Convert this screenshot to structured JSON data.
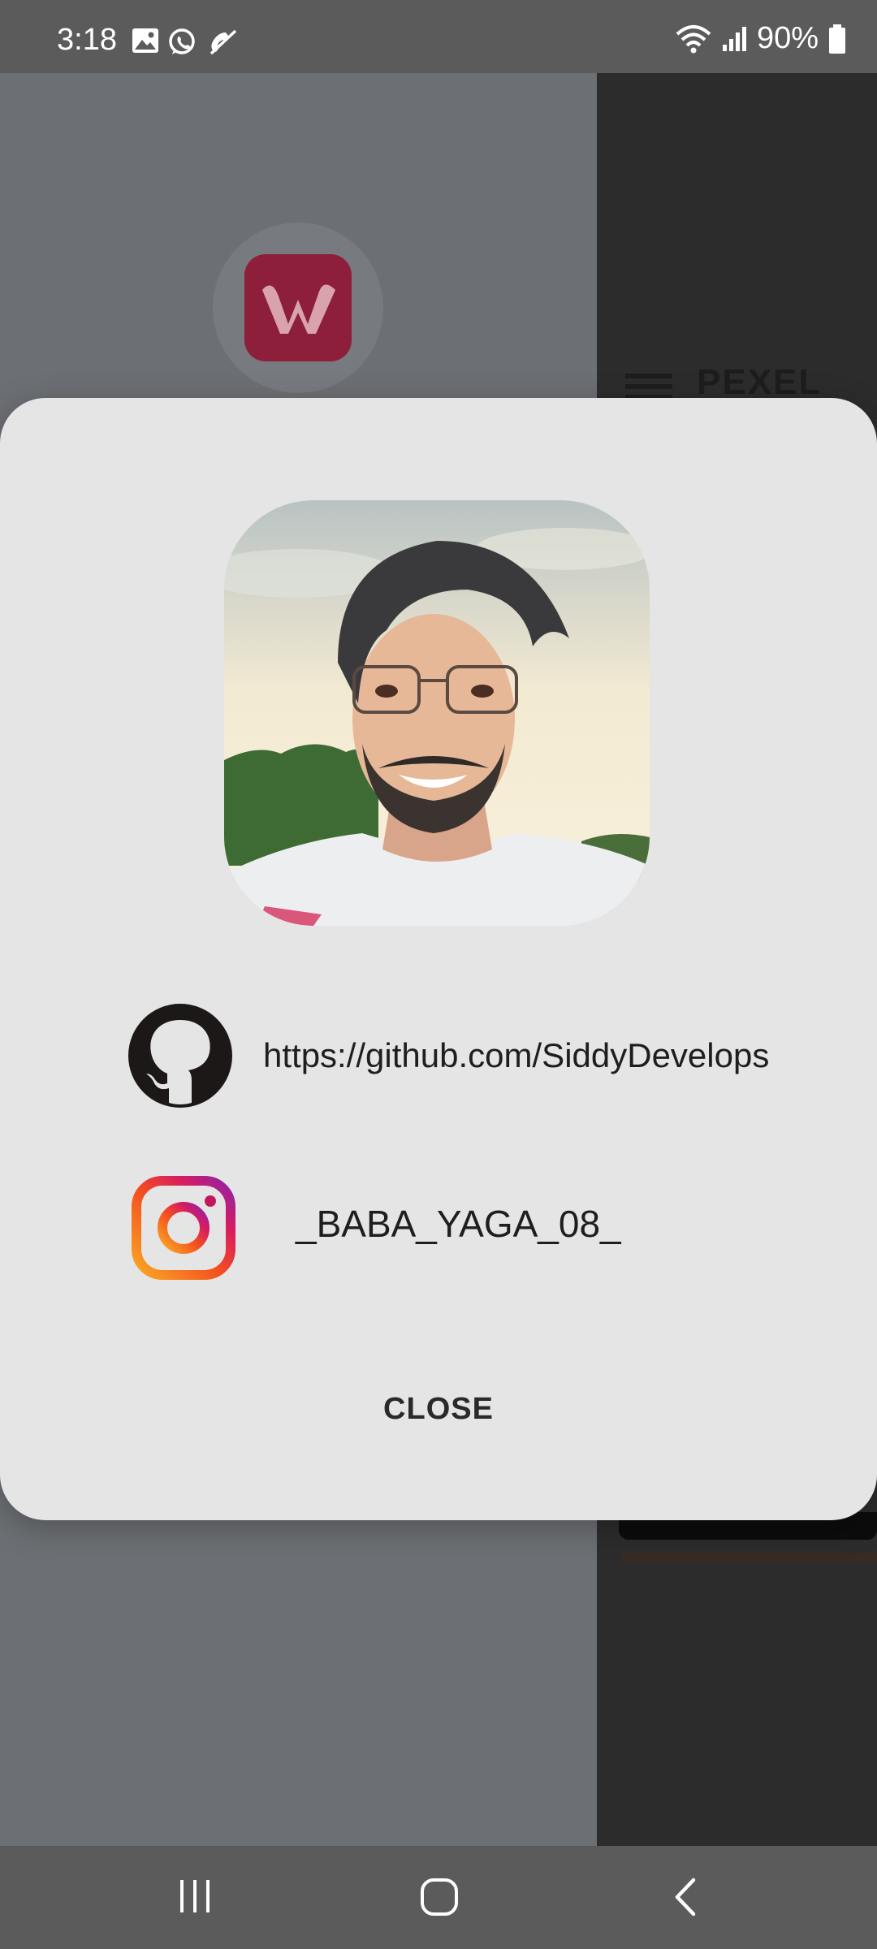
{
  "status_bar": {
    "time": "3:18",
    "battery": "90%",
    "icons": [
      "gallery-icon",
      "whatsapp-icon",
      "muted-call-icon",
      "wifi-icon",
      "signal-icon",
      "battery-icon"
    ]
  },
  "background_app": {
    "title": "PEXEL",
    "logo_icon": "app-logo-w-icon",
    "menu_icon": "hamburger-menu-icon"
  },
  "dialog": {
    "links": {
      "github": {
        "icon": "github-icon",
        "text": "https://github.com/SiddyDevelops"
      },
      "instagram": {
        "icon": "instagram-icon",
        "text": "_BABA_YAGA_08_"
      }
    },
    "close_label": "CLOSE"
  },
  "nav_bar": {
    "buttons": [
      "recents-icon",
      "home-icon",
      "back-icon"
    ]
  },
  "colors": {
    "dialog_bg": "#e5e5e5",
    "scrim": "#6a6d70",
    "logo": "#8e1f3a"
  }
}
